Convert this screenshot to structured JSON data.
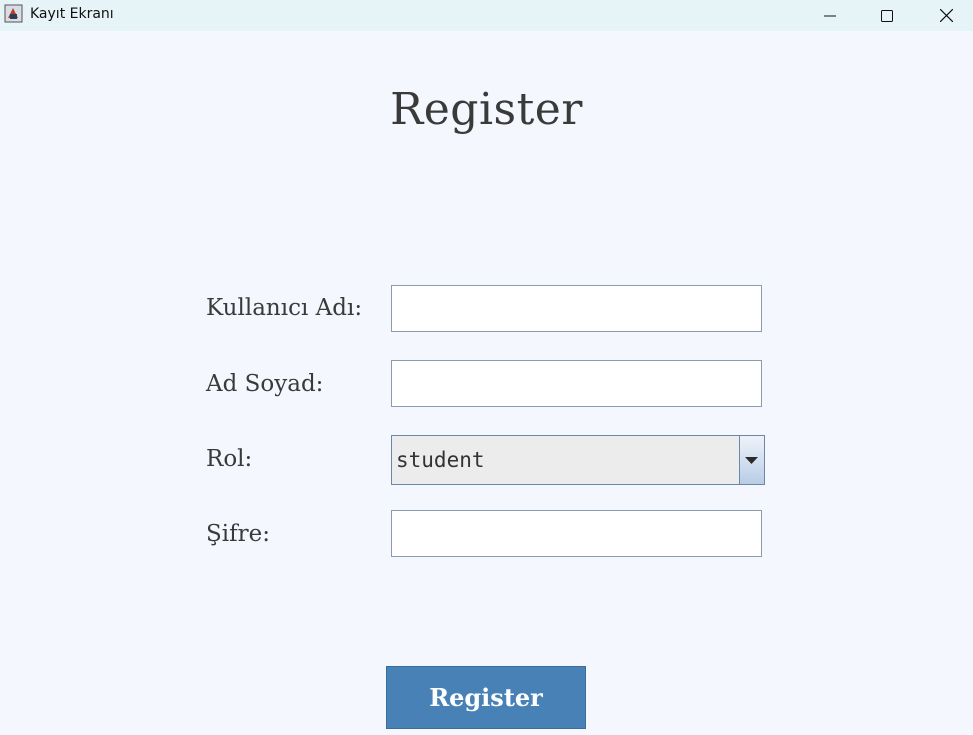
{
  "window": {
    "title": "Kayıt Ekranı",
    "controls": [
      "minimize-icon",
      "maximize-icon",
      "close-icon"
    ]
  },
  "form": {
    "heading": "Register",
    "fields": {
      "username_label": "Kullanıcı Adı:",
      "username_value": "",
      "fullname_label": "Ad Soyad:",
      "fullname_value": "",
      "role_label": "Rol:",
      "role_value": "student",
      "password_label": "Şifre:",
      "password_value": ""
    },
    "submit_label": "Register"
  },
  "colors": {
    "background": "#f4f7fd",
    "titlebar": "#e6f4f7",
    "button": "#4781b6",
    "text": "#3a3a3a"
  }
}
